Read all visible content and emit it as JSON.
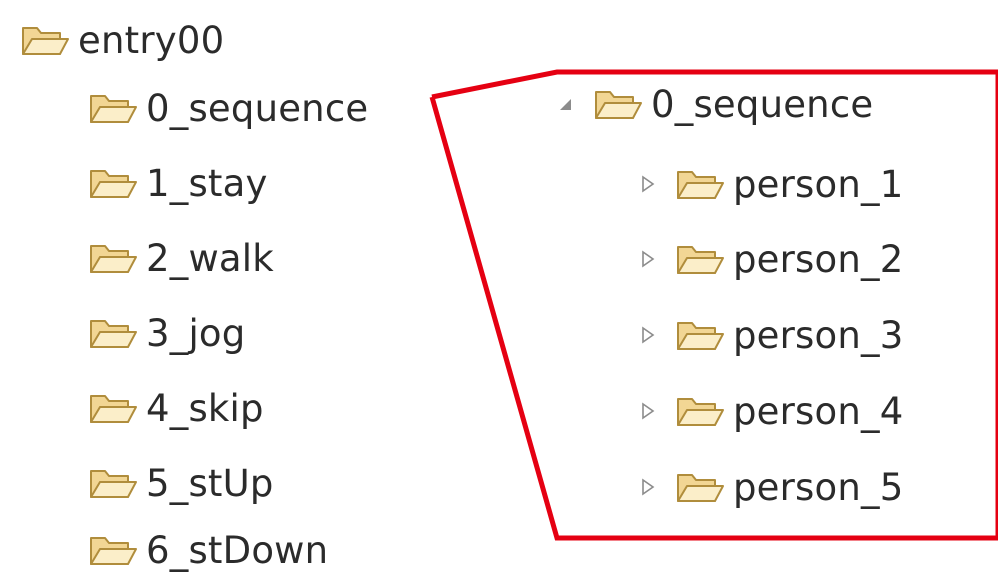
{
  "colors": {
    "highlight": "#e50012",
    "folder_outline": "#b08d3c",
    "folder_fill": "#f2d694",
    "expander": "#8c8c8c"
  },
  "left_tree": {
    "root": {
      "label": "entry00",
      "icon": "folder-open-icon"
    },
    "children": [
      {
        "label": "0_sequence",
        "icon": "folder-open-icon"
      },
      {
        "label": "1_stay",
        "icon": "folder-open-icon"
      },
      {
        "label": "2_walk",
        "icon": "folder-open-icon"
      },
      {
        "label": "3_jog",
        "icon": "folder-open-icon"
      },
      {
        "label": "4_skip",
        "icon": "folder-open-icon"
      },
      {
        "label": "5_stUp",
        "icon": "folder-open-icon"
      },
      {
        "label": "6_stDown",
        "icon": "folder-open-icon"
      }
    ]
  },
  "right_tree": {
    "root": {
      "label": "0_sequence",
      "icon": "folder-open-icon",
      "expander": "expanded-triangle-icon"
    },
    "children": [
      {
        "label": "person_1",
        "icon": "folder-open-icon",
        "expander": "collapsed-triangle-icon"
      },
      {
        "label": "person_2",
        "icon": "folder-open-icon",
        "expander": "collapsed-triangle-icon"
      },
      {
        "label": "person_3",
        "icon": "folder-open-icon",
        "expander": "collapsed-triangle-icon"
      },
      {
        "label": "person_4",
        "icon": "folder-open-icon",
        "expander": "collapsed-triangle-icon"
      },
      {
        "label": "person_5",
        "icon": "folder-open-icon",
        "expander": "collapsed-triangle-icon"
      }
    ]
  }
}
